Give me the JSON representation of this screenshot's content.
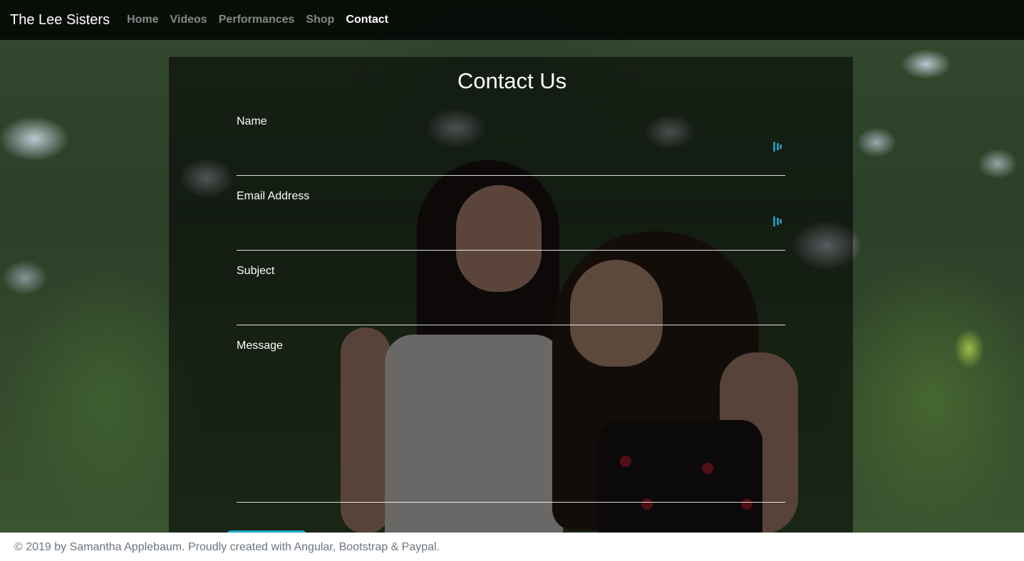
{
  "navbar": {
    "brand": "The Lee Sisters",
    "links": [
      {
        "label": "Home",
        "active": false
      },
      {
        "label": "Videos",
        "active": false
      },
      {
        "label": "Performances",
        "active": false
      },
      {
        "label": "Shop",
        "active": false
      },
      {
        "label": "Contact",
        "active": true
      }
    ]
  },
  "contact": {
    "title": "Contact Us",
    "fields": {
      "name": {
        "label": "Name",
        "value": ""
      },
      "email": {
        "label": "Email Address",
        "value": ""
      },
      "subject": {
        "label": "Subject",
        "value": ""
      },
      "message": {
        "label": "Message",
        "value": ""
      }
    },
    "icons": {
      "password_manager": "password-manager-icon"
    }
  },
  "footer": {
    "text": "© 2019 by Samantha Applebaum. Proudly created with Angular, Bootstrap & Paypal."
  },
  "colors": {
    "accent": "#1ba6c6",
    "navbar_bg": "#000000",
    "footer_text": "#6c757d"
  }
}
